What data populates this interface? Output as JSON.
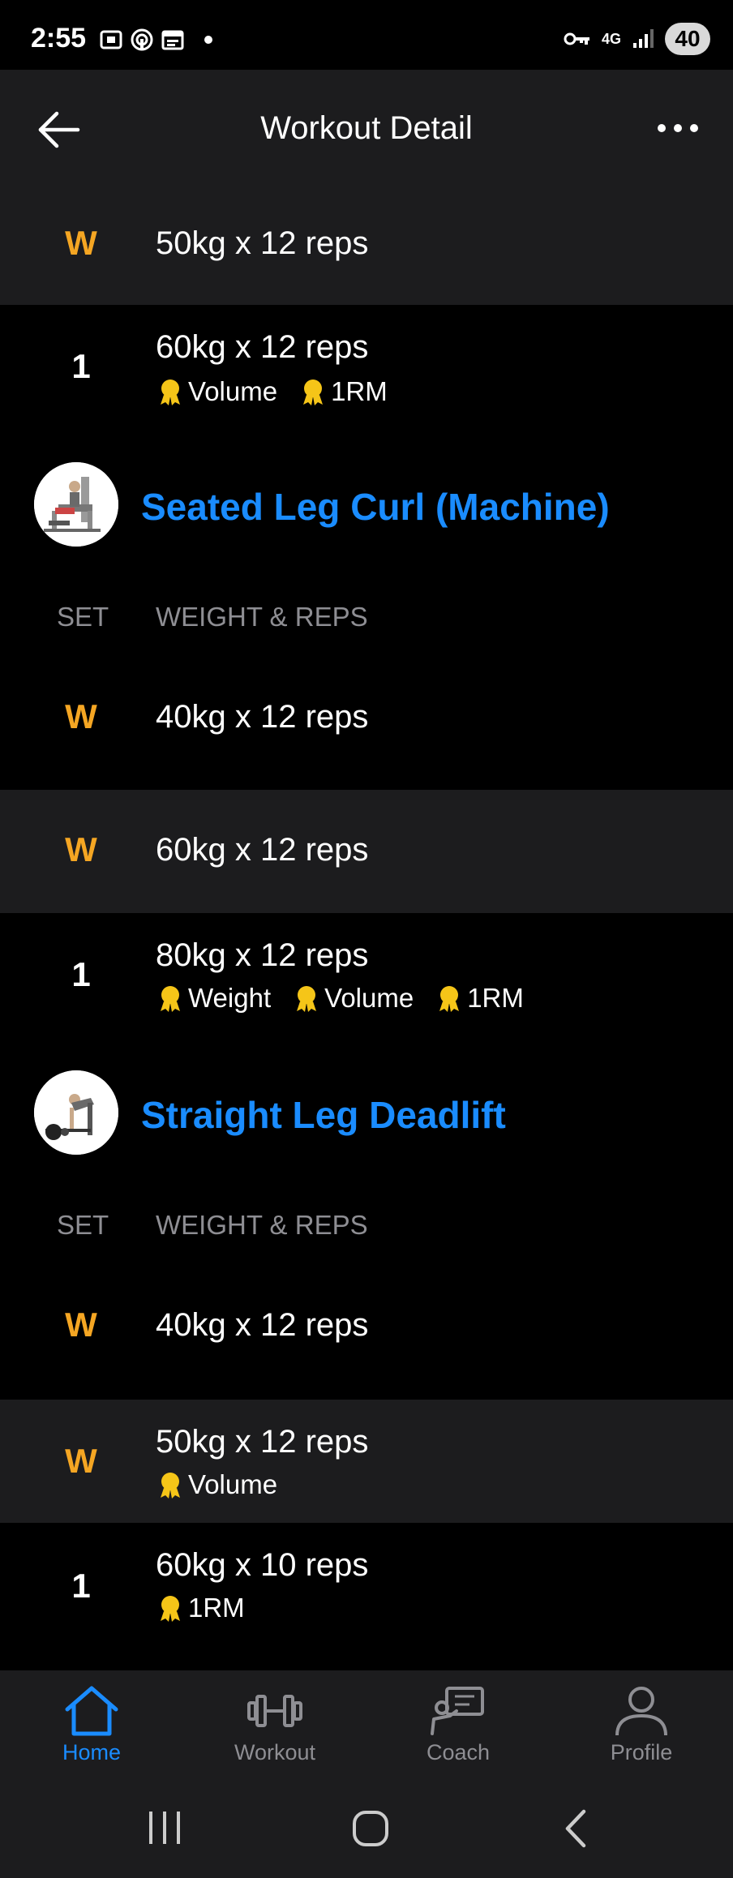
{
  "status_bar": {
    "time": "2:55",
    "network": "4G",
    "battery": "40",
    "icons": [
      "screenshot-icon",
      "hotspot-icon",
      "calendar-icon",
      "key-icon",
      "signal-icon"
    ]
  },
  "header": {
    "title": "Workout Detail",
    "back_icon": "arrow-left-icon",
    "more_icon": "more-horizontal-icon"
  },
  "top_sets": [
    {
      "badge": "W",
      "type": "warmup",
      "weight_reps": "50kg x 12 reps",
      "records": []
    },
    {
      "badge": "1",
      "type": "working",
      "weight_reps": "60kg x 12 reps",
      "records": [
        "Volume",
        "1RM"
      ]
    }
  ],
  "exercises": [
    {
      "name": "Seated Leg Curl (Machine)",
      "columns": {
        "set": "SET",
        "weight_reps": "WEIGHT & REPS"
      },
      "sets": [
        {
          "badge": "W",
          "type": "warmup",
          "weight_reps": "40kg x 12 reps",
          "records": []
        },
        {
          "badge": "W",
          "type": "warmup",
          "weight_reps": "60kg x 12 reps",
          "records": []
        },
        {
          "badge": "1",
          "type": "working",
          "weight_reps": "80kg x 12 reps",
          "records": [
            "Weight",
            "Volume",
            "1RM"
          ]
        }
      ]
    },
    {
      "name": "Straight Leg Deadlift",
      "columns": {
        "set": "SET",
        "weight_reps": "WEIGHT & REPS"
      },
      "sets": [
        {
          "badge": "W",
          "type": "warmup",
          "weight_reps": "40kg x 12 reps",
          "records": []
        },
        {
          "badge": "W",
          "type": "warmup",
          "weight_reps": "50kg x 12 reps",
          "records": [
            "Volume"
          ]
        },
        {
          "badge": "1",
          "type": "working",
          "weight_reps": "60kg x 10 reps",
          "records": [
            "1RM"
          ]
        }
      ]
    }
  ],
  "bottom_nav": {
    "items": [
      {
        "label": "Home",
        "icon": "home-icon",
        "active": true
      },
      {
        "label": "Workout",
        "icon": "dumbbell-icon",
        "active": false
      },
      {
        "label": "Coach",
        "icon": "coach-icon",
        "active": false
      },
      {
        "label": "Profile",
        "icon": "profile-icon",
        "active": false
      }
    ]
  },
  "colors": {
    "accent": "#1a8cff",
    "warmup": "#f5a623",
    "row_alt": "#1c1c1e",
    "muted": "#8e8e93"
  }
}
